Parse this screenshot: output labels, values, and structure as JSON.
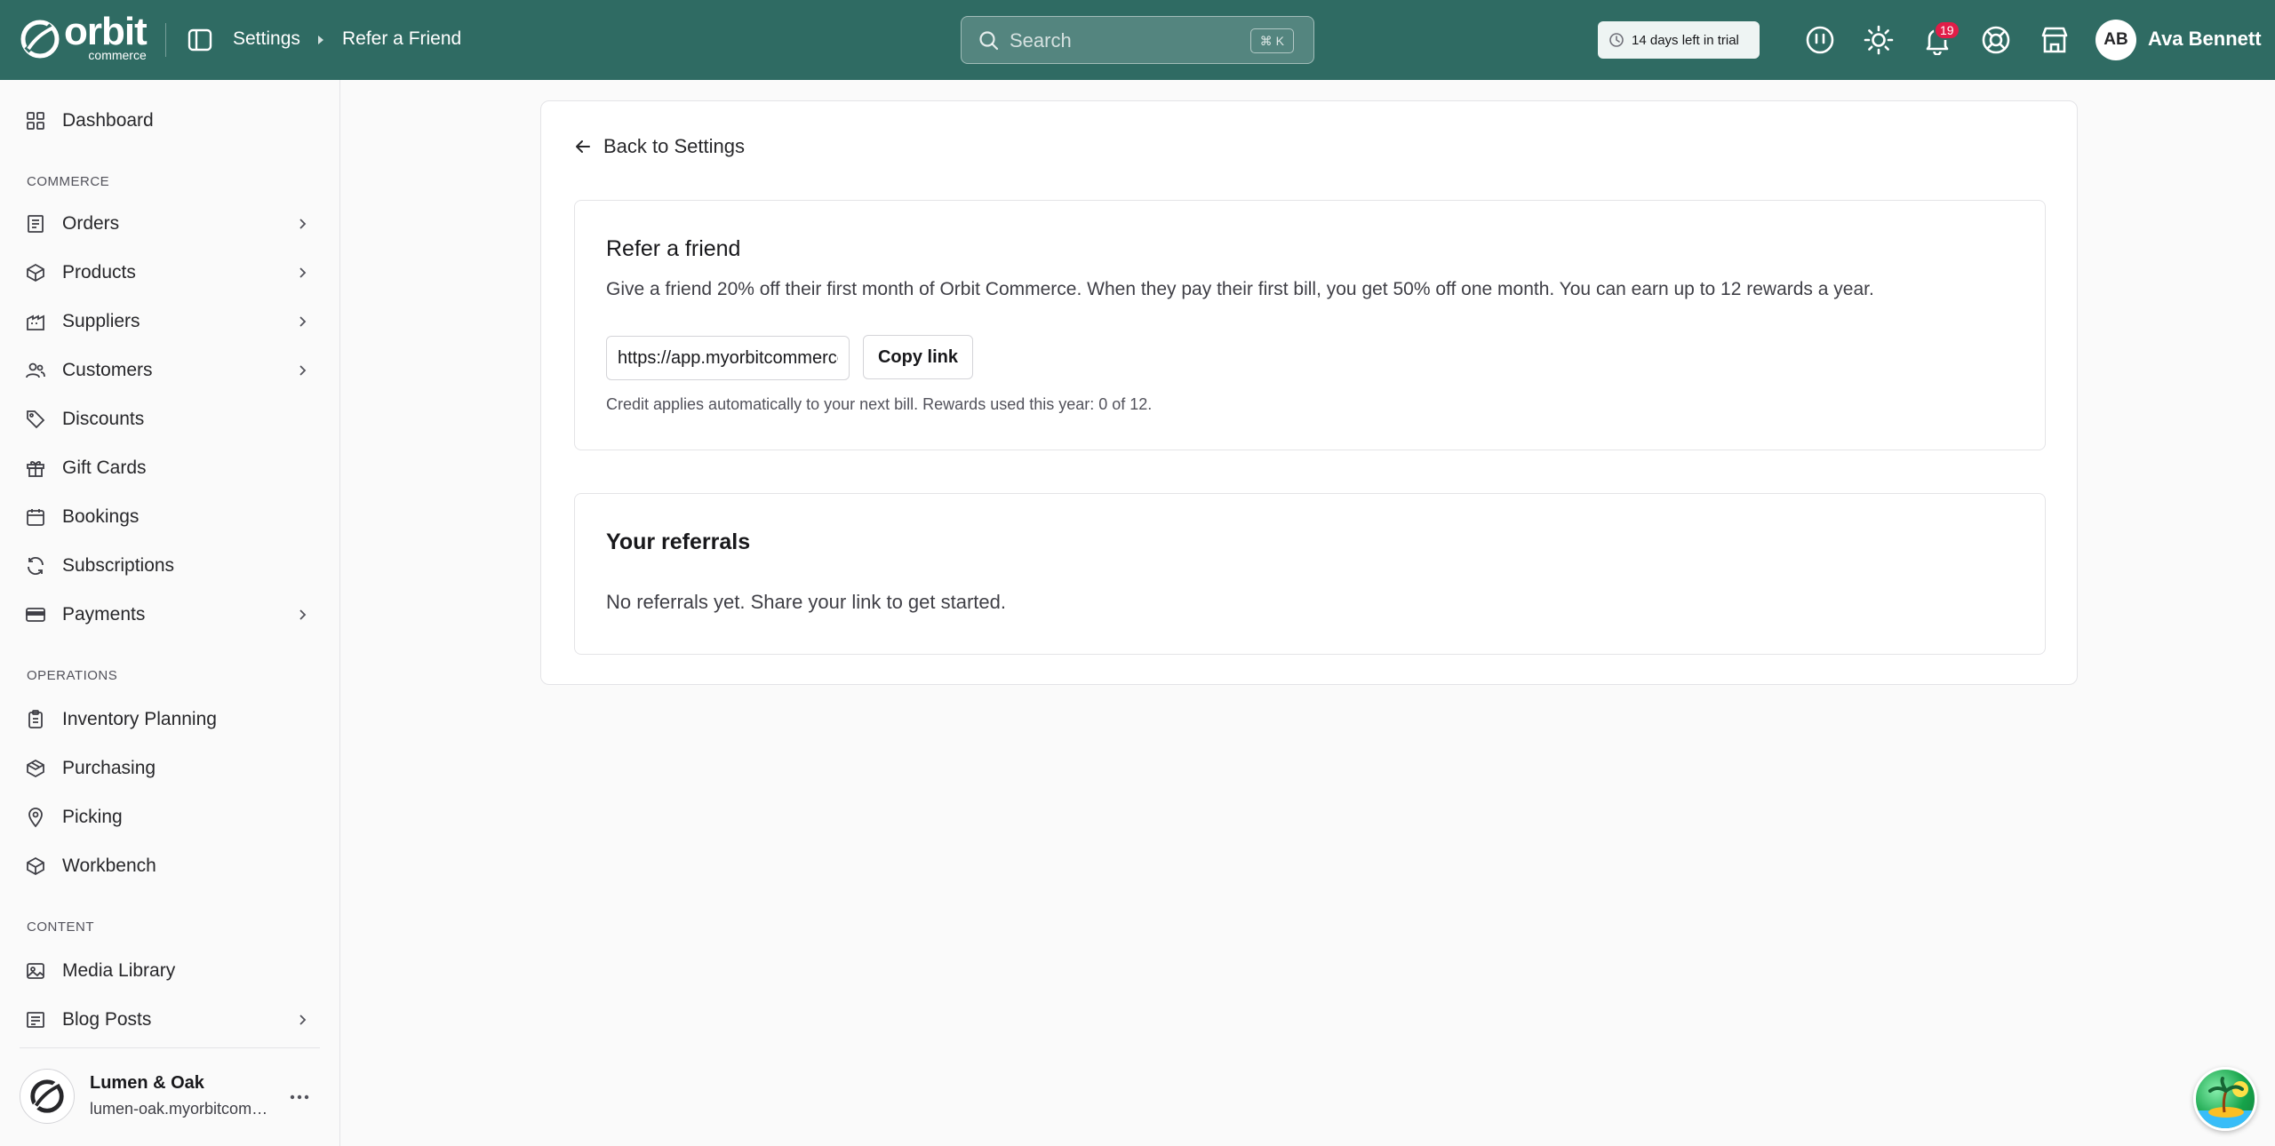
{
  "brand": {
    "name": "orbit",
    "subname": "commerce"
  },
  "header": {
    "breadcrumb": [
      "Settings",
      "Refer a Friend"
    ],
    "search_placeholder": "Search",
    "search_shortcut": "⌘ K",
    "trial_text": "14 days left in trial",
    "notification_count": "19",
    "user_initials": "AB",
    "user_name": "Ava Bennett"
  },
  "sidebar": {
    "top": [
      {
        "label": "Dashboard",
        "icon": "dashboard-icon"
      }
    ],
    "sections": [
      {
        "label": "COMMERCE",
        "items": [
          {
            "label": "Orders",
            "icon": "orders-icon",
            "expandable": true
          },
          {
            "label": "Products",
            "icon": "products-icon",
            "expandable": true
          },
          {
            "label": "Suppliers",
            "icon": "suppliers-icon",
            "expandable": true
          },
          {
            "label": "Customers",
            "icon": "customers-icon",
            "expandable": true
          },
          {
            "label": "Discounts",
            "icon": "tag-icon",
            "expandable": false
          },
          {
            "label": "Gift Cards",
            "icon": "gift-icon",
            "expandable": false
          },
          {
            "label": "Bookings",
            "icon": "calendar-icon",
            "expandable": false
          },
          {
            "label": "Subscriptions",
            "icon": "refresh-icon",
            "expandable": false
          },
          {
            "label": "Payments",
            "icon": "card-icon",
            "expandable": true
          }
        ]
      },
      {
        "label": "OPERATIONS",
        "items": [
          {
            "label": "Inventory Planning",
            "icon": "clipboard-icon"
          },
          {
            "label": "Purchasing",
            "icon": "package-icon"
          },
          {
            "label": "Picking",
            "icon": "map-pin-icon"
          },
          {
            "label": "Workbench",
            "icon": "box-icon"
          }
        ]
      },
      {
        "label": "CONTENT",
        "items": [
          {
            "label": "Media Library",
            "icon": "image-icon",
            "expandable": false
          },
          {
            "label": "Blog Posts",
            "icon": "blog-icon",
            "expandable": true
          }
        ]
      }
    ],
    "store": {
      "name": "Lumen & Oak",
      "domain": "lumen-oak.myorbitcommerce.com"
    }
  },
  "main": {
    "back_label": "Back to Settings",
    "refer": {
      "title": "Refer a friend",
      "description": "Give a friend 20% off their first month of Orbit Commerce. When they pay their first bill, you get 50% off one month. You can earn up to 12 rewards a year.",
      "link_value": "https://app.myorbitcommerce.com",
      "copy_label": "Copy link",
      "note": "Credit applies automatically to your next bill. Rewards used this year: 0 of 12."
    },
    "referrals": {
      "title": "Your referrals",
      "empty_text": "No referrals yet. Share your link to get started."
    }
  },
  "colors": {
    "header_bg": "#2f6b63",
    "badge": "#e11d48"
  }
}
